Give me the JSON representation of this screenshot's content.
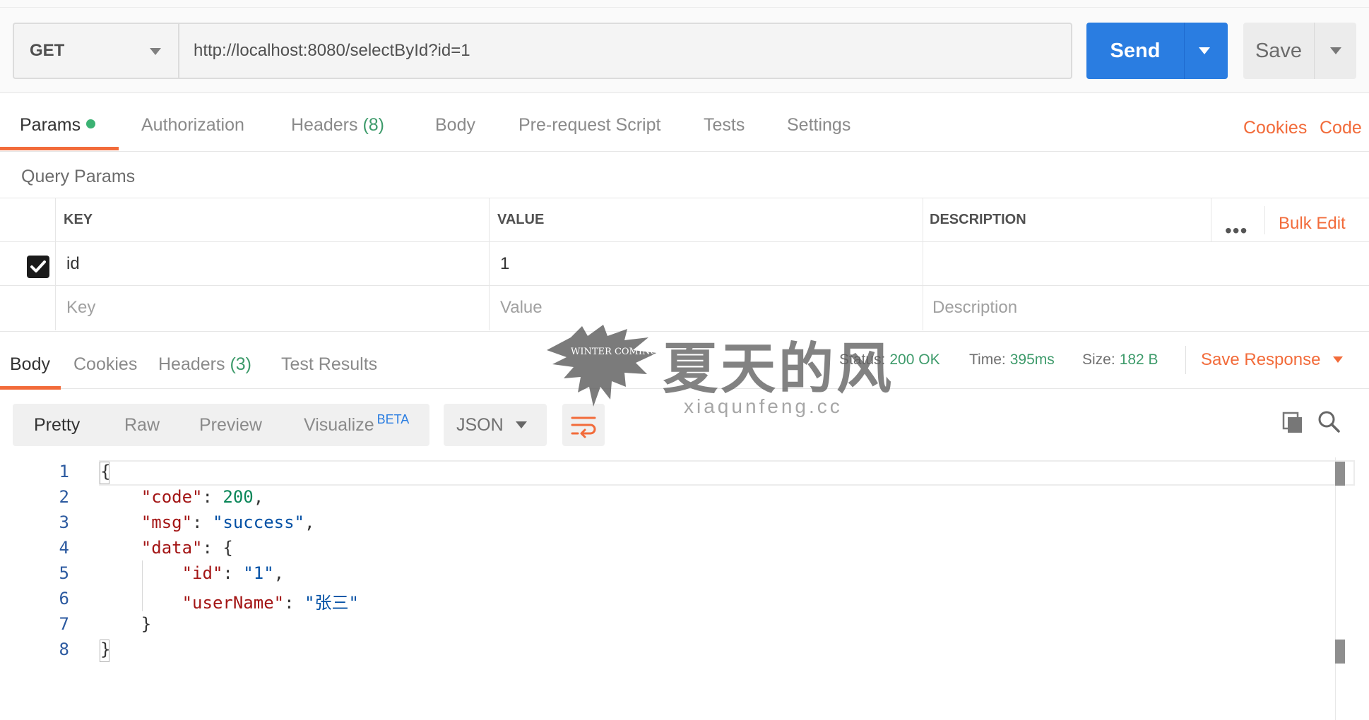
{
  "request": {
    "method": "GET",
    "url": "http://localhost:8080/selectById?id=1",
    "send_label": "Send",
    "save_label": "Save"
  },
  "request_tabs": {
    "params": "Params",
    "authorization": "Authorization",
    "headers": "Headers",
    "headers_count": "(8)",
    "body": "Body",
    "prerequest": "Pre-request Script",
    "tests": "Tests",
    "settings": "Settings",
    "cookies_link": "Cookies",
    "code_link": "Code"
  },
  "query_params": {
    "title": "Query Params",
    "columns": {
      "key": "KEY",
      "value": "VALUE",
      "description": "DESCRIPTION"
    },
    "more": "•••",
    "bulk_edit": "Bulk Edit",
    "rows": [
      {
        "key": "id",
        "value": "1",
        "description": "",
        "checked": true
      }
    ],
    "placeholders": {
      "key": "Key",
      "value": "Value",
      "description": "Description"
    }
  },
  "response_tabs": {
    "body": "Body",
    "cookies": "Cookies",
    "headers": "Headers",
    "headers_count": "(3)",
    "test_results": "Test Results"
  },
  "response_status": {
    "status_label": "Status:",
    "status_value": "200 OK",
    "time_label": "Time:",
    "time_value": "395ms",
    "size_label": "Size:",
    "size_value": "182 B",
    "save_response": "Save Response"
  },
  "view_options": {
    "pretty": "Pretty",
    "raw": "Raw",
    "preview": "Preview",
    "visualize": "Visualize",
    "beta": "BETA",
    "format": "JSON"
  },
  "response_body": {
    "line_numbers": [
      "1",
      "2",
      "3",
      "4",
      "5",
      "6",
      "7",
      "8"
    ],
    "open_brace": "{",
    "close_brace": "}",
    "code_key": "\"code\"",
    "code_value": "200",
    "msg_key": "\"msg\"",
    "msg_value": "\"success\"",
    "data_key": "\"data\"",
    "id_key": "\"id\"",
    "id_value": "\"1\"",
    "username_key": "\"userName\"",
    "username_value": "\"张三\""
  },
  "watermark": {
    "title": "夏天的风",
    "subtitle": "xiaqunfeng.cc",
    "logo_text": "WINTER COMING"
  },
  "colors": {
    "accent_orange": "#f26b3a",
    "send_blue": "#2a7de1",
    "status_green": "#3e9b6b"
  }
}
